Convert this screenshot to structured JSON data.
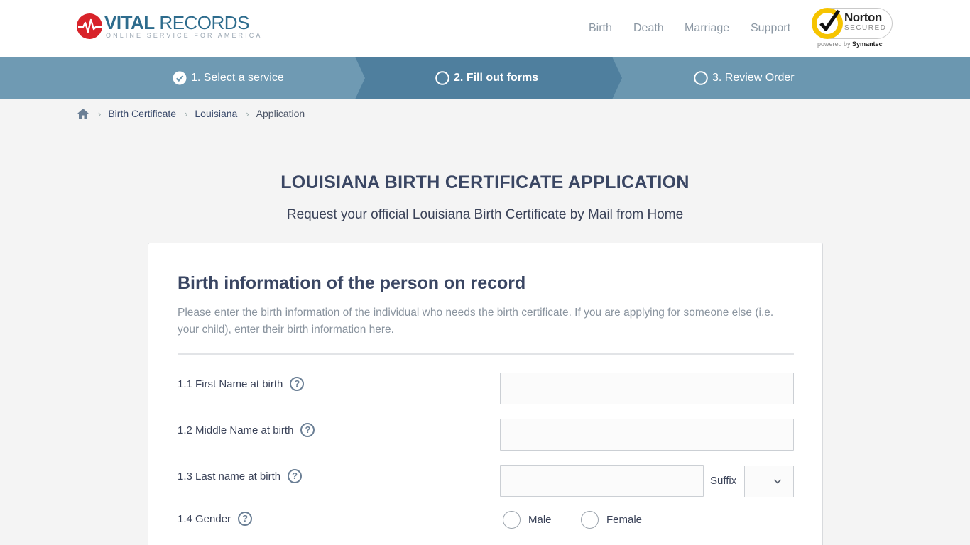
{
  "header": {
    "logo": {
      "title_bold": "VITAL",
      "title_rest": " RECORDS",
      "tagline": "ONLINE SERVICE FOR AMERICA"
    },
    "nav": [
      {
        "label": "Birth"
      },
      {
        "label": "Death"
      },
      {
        "label": "Marriage"
      },
      {
        "label": "Support"
      }
    ],
    "norton": {
      "name": "Norton",
      "secured": "SECURED",
      "powered_by": "powered by",
      "brand": "Symantec"
    }
  },
  "steps": [
    {
      "label": "1. Select a service",
      "state": "done"
    },
    {
      "label": "2. Fill out forms",
      "state": "active"
    },
    {
      "label": "3. Review Order",
      "state": "pending"
    }
  ],
  "breadcrumb": {
    "items": [
      {
        "label": "Birth Certificate"
      },
      {
        "label": "Louisiana"
      }
    ],
    "current": "Application"
  },
  "page": {
    "title": "LOUISIANA BIRTH CERTIFICATE APPLICATION",
    "subtitle": "Request your official Louisiana Birth Certificate by Mail from Home"
  },
  "form": {
    "title": "Birth information of the person on record",
    "description": "Please enter the birth information of the individual who needs the birth certificate. If you are applying for someone else (i.e. your child), enter their birth information here.",
    "fields": {
      "first_name": {
        "label": "1.1 First Name at birth",
        "value": ""
      },
      "middle_name": {
        "label": "1.2 Middle Name at birth",
        "value": ""
      },
      "last_name": {
        "label": "1.3 Last name at birth",
        "value": ""
      },
      "suffix": {
        "label": "Suffix",
        "value": ""
      },
      "gender": {
        "label": "1.4 Gender",
        "options": [
          "Male",
          "Female"
        ],
        "selected": ""
      }
    },
    "help_glyph": "?"
  },
  "colors": {
    "brand_blue": "#2e6c8d",
    "brand_red": "#d8232a",
    "step_bar": "#6b97b0",
    "step_active": "#4f7f9e",
    "heading": "#3a4663"
  }
}
